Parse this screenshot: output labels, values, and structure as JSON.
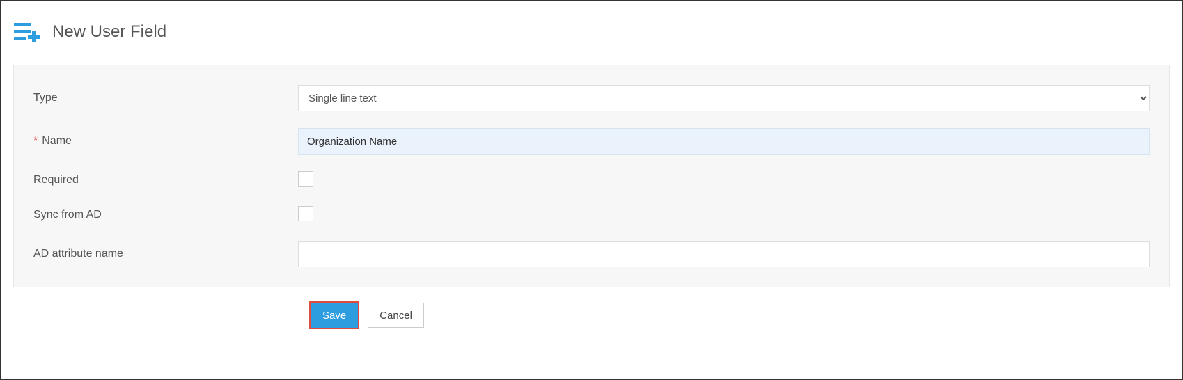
{
  "header": {
    "title": "New User Field"
  },
  "form": {
    "type": {
      "label": "Type",
      "selected": "Single line text"
    },
    "name": {
      "label": "Name",
      "required_mark": "*",
      "value": "Organization Name"
    },
    "required": {
      "label": "Required",
      "checked": false
    },
    "sync_from_ad": {
      "label": "Sync from AD",
      "checked": false
    },
    "ad_attribute": {
      "label": "AD attribute name",
      "value": ""
    }
  },
  "actions": {
    "save_label": "Save",
    "cancel_label": "Cancel"
  }
}
